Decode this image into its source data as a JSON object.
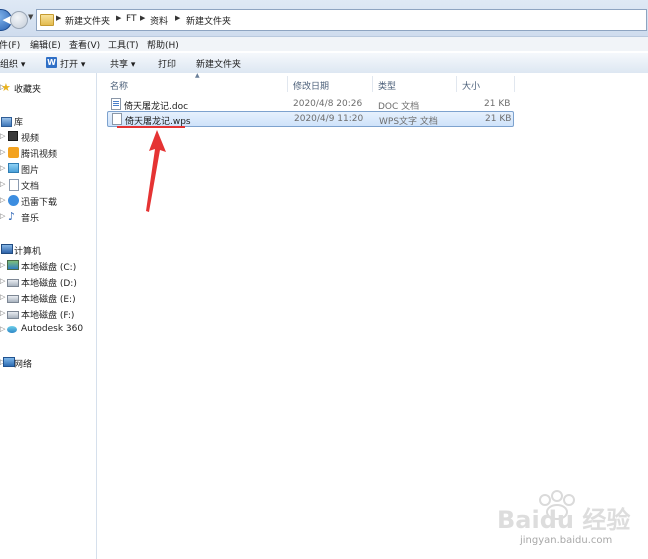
{
  "address": {
    "breadcrumbs": [
      "新建文件夹",
      "FT",
      "资料",
      "新建文件夹"
    ]
  },
  "menu": {
    "items": [
      "件(F)",
      "编辑(E)",
      "查看(V)",
      "工具(T)",
      "帮助(H)"
    ]
  },
  "toolbar": {
    "organize_label": "组织 ▾",
    "open_label": "打开 ▾",
    "share_label": "共享 ▾",
    "print_label": "打印",
    "new_folder_label": "新建文件夹"
  },
  "nav": {
    "favorites": "收藏夹",
    "libraries": "库",
    "library_items": [
      "视频",
      "腾讯视频",
      "图片",
      "文档",
      "迅雷下载",
      "音乐"
    ],
    "computer": "计算机",
    "drives": [
      "本地磁盘 (C:)",
      "本地磁盘 (D:)",
      "本地磁盘 (E:)",
      "本地磁盘 (F:)",
      "Autodesk 360"
    ],
    "network": "网络"
  },
  "columns": [
    "名称",
    "修改日期",
    "类型",
    "大小"
  ],
  "files": [
    {
      "name": "倚天屠龙记.doc",
      "modified": "2020/4/8 20:26",
      "type": "DOC 文档",
      "size": "21 KB",
      "selected": false
    },
    {
      "name": "倚天屠龙记.wps",
      "modified": "2020/4/9 11:20",
      "type": "WPS文字 文档",
      "size": "21 KB",
      "selected": true
    }
  ],
  "annotation": {
    "color": "#e53333"
  },
  "watermark": {
    "brand": "Baidu 经验",
    "url": "jingyan.baidu.com"
  }
}
